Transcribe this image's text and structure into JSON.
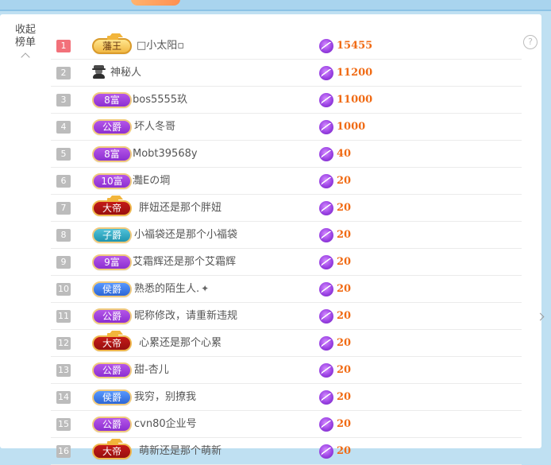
{
  "side": {
    "toggle_label_line1": "收起",
    "toggle_label_line2": "榜单",
    "help_icon": "?"
  },
  "colors": {
    "score": "#f06b15",
    "rank_first_bg": "#f2717a",
    "rank_default_bg": "#bcbcbc"
  },
  "leaderboard": [
    {
      "rank": "1",
      "badge_type": "gold",
      "badge_text": "藩王",
      "name": "□小太阳▫",
      "score": "15455"
    },
    {
      "rank": "2",
      "badge_type": "mystery-avatar",
      "badge_text": "",
      "name": "神秘人",
      "score": "11200"
    },
    {
      "rank": "3",
      "badge_type": "purple",
      "badge_text": "8富",
      "name": "bos5555玖",
      "score": "11000"
    },
    {
      "rank": "4",
      "badge_type": "purple",
      "badge_text": "公爵",
      "name": "坏人冬哥",
      "score": "1000"
    },
    {
      "rank": "5",
      "badge_type": "purple",
      "badge_text": "8富",
      "name": "Mobt39568y",
      "score": "40"
    },
    {
      "rank": "6",
      "badge_type": "purple",
      "badge_text": "10富",
      "name": "灩Eの堈",
      "score": "20"
    },
    {
      "rank": "7",
      "badge_type": "red",
      "badge_text": "大帝",
      "name": "胖妞还是那个胖妞",
      "score": "20"
    },
    {
      "rank": "8",
      "badge_type": "teal",
      "badge_text": "子爵",
      "name": "小福袋还是那个小福袋",
      "score": "20"
    },
    {
      "rank": "9",
      "badge_type": "purple",
      "badge_text": "9富",
      "name": "艾霜辉还是那个艾霜辉",
      "score": "20"
    },
    {
      "rank": "10",
      "badge_type": "blue",
      "badge_text": "侯爵",
      "name": "熟悉的陌生人.",
      "score": "20"
    },
    {
      "rank": "11",
      "badge_type": "purple",
      "badge_text": "公爵",
      "name": "昵称修改，请重新违规",
      "score": "20"
    },
    {
      "rank": "12",
      "badge_type": "red",
      "badge_text": "大帝",
      "name": "心累还是那个心累",
      "score": "20"
    },
    {
      "rank": "13",
      "badge_type": "purple",
      "badge_text": "公爵",
      "name": "甜-杏儿",
      "score": "20"
    },
    {
      "rank": "14",
      "badge_type": "blue",
      "badge_text": "侯爵",
      "name": "我穷，别撩我",
      "score": "20"
    },
    {
      "rank": "15",
      "badge_type": "purple",
      "badge_text": "公爵",
      "name": "cvn80企业号",
      "score": "20"
    },
    {
      "rank": "16",
      "badge_type": "red",
      "badge_text": "大帝",
      "name": "萌新还是那个萌新",
      "score": "20"
    }
  ]
}
